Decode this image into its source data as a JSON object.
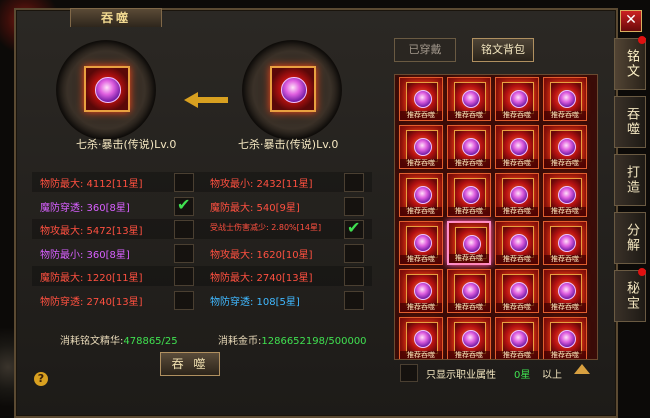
{
  "window": {
    "title": "吞噬",
    "close_label": "✕"
  },
  "medals": {
    "source": {
      "name": "七杀·暴击(传说)Lv.0"
    },
    "target": {
      "name": "七杀·暴击(传说)Lv.0"
    }
  },
  "stats": [
    {
      "text": "物防最大: 4112[11星]",
      "color": "#ff5040",
      "checked": false
    },
    {
      "text": "物攻最小: 2432[11星]",
      "color": "#ff5040",
      "checked": false
    },
    {
      "text": "魔防穿透: 360[8星]",
      "color": "#d860ff",
      "checked": true
    },
    {
      "text": "魔防最大: 540[9星]",
      "color": "#ff5040",
      "checked": false
    },
    {
      "text": "物攻最大: 5472[13星]",
      "color": "#ff5040",
      "checked": false
    },
    {
      "text": "受战士伤害减少: 2.80%[14星]",
      "color": "#ff5040",
      "checked": true
    },
    {
      "text": "物防最小: 360[8星]",
      "color": "#d860ff",
      "checked": false
    },
    {
      "text": "物攻最大: 1620[10星]",
      "color": "#ff5040",
      "checked": false
    },
    {
      "text": "魔防最大: 1220[11星]",
      "color": "#ff5040",
      "checked": false
    },
    {
      "text": "物防最大: 2740[13星]",
      "color": "#ff5040",
      "checked": false
    },
    {
      "text": "物防穿透: 2740[13星]",
      "color": "#ff5040",
      "checked": false
    },
    {
      "text": "物防穿透: 108[5星]",
      "color": "#40b8ff",
      "checked": false
    }
  ],
  "costs": {
    "essence_label": "消耗铭文精华:",
    "essence_value": "478865/25",
    "gold_label": "消耗金币:",
    "gold_value": "1286652198/500000"
  },
  "actions": {
    "devour": "吞 噬",
    "help": "?"
  },
  "tabs": {
    "worn": "已穿戴",
    "bag": "铭文背包"
  },
  "grid": {
    "slot_tag": "推荐吞噬",
    "rows": 6,
    "cols": 4,
    "selected_index": 13
  },
  "filter": {
    "label": "只显示职业属性",
    "star_value": "0星",
    "above_label": "以上"
  },
  "side_tabs": [
    {
      "label": "铭文",
      "active": true,
      "dot": true
    },
    {
      "label": "吞噬",
      "active": false,
      "dot": false
    },
    {
      "label": "打造",
      "active": false,
      "dot": false
    },
    {
      "label": "分解",
      "active": false,
      "dot": false
    },
    {
      "label": "秘宝",
      "active": false,
      "dot": true
    }
  ],
  "colors": {
    "accent_gold": "#d8a040",
    "value_green": "#40e050"
  }
}
